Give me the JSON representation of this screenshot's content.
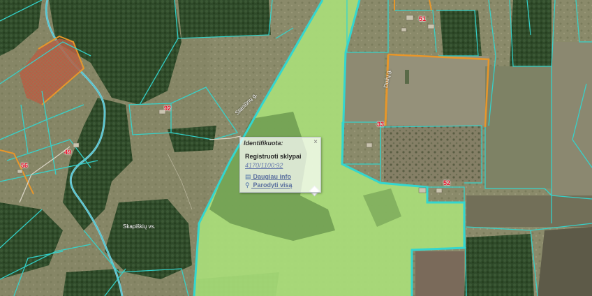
{
  "popup": {
    "title": "Identifikuota:",
    "close_label": "×",
    "layer": "Registruoti sklypai",
    "plot_id": "4170/1100:92",
    "more_info": "Daugiau info",
    "show_all": "Parodyti visą",
    "more_info_icon": "document-icon",
    "show_all_icon": "magnifier-icon"
  },
  "parcel_labels": [
    "92",
    "33",
    "49",
    "51",
    "52",
    "56"
  ],
  "road_labels": [
    "Staniūnų g.",
    "Dulių g.",
    "Skapiškių vs."
  ],
  "colors": {
    "parcel_boundary": "#33d6cf",
    "highlight_boundary": "#e8962a",
    "selected_fill": "#b9f08a",
    "label": "#e8102a"
  }
}
